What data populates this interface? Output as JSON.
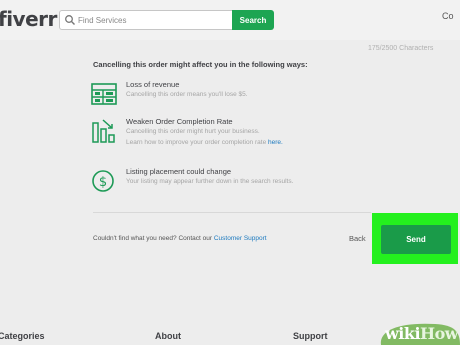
{
  "header": {
    "logo": "fiverr",
    "search_placeholder": "Find Services",
    "search_button": "Search",
    "right_cut_text": "Co"
  },
  "char_count": "175/2500 Characters",
  "intro": "Cancelling this order might affect you in the following ways:",
  "items": [
    {
      "icon": "revenue-icon",
      "title": "Loss of revenue",
      "desc": [
        "Cancelling this order means you'll lose $5."
      ]
    },
    {
      "icon": "bar-chart-decline-icon",
      "title": "Weaken Order Completion Rate",
      "desc": [
        "Cancelling this order might hurt your business.",
        "Learn how to improve your order completion rate"
      ],
      "link": "here."
    },
    {
      "icon": "dollar-circle-icon",
      "title": "Listing placement could change",
      "desc": [
        "Your listing may appear further down in the search results."
      ]
    }
  ],
  "support": {
    "text": "Couldn't find what you need? Contact our",
    "link": "Customer Support"
  },
  "actions": {
    "back": "Back",
    "send": "Send",
    "highlight_color": "#24f01e"
  },
  "footer": {
    "categories": "Categories",
    "about": "About",
    "support": "Support"
  },
  "watermark": {
    "wiki": "wiki",
    "how": "How"
  },
  "colors": {
    "brand_green": "#1da552",
    "send_green": "#1a9b49",
    "link_blue": "#1d7abf"
  }
}
